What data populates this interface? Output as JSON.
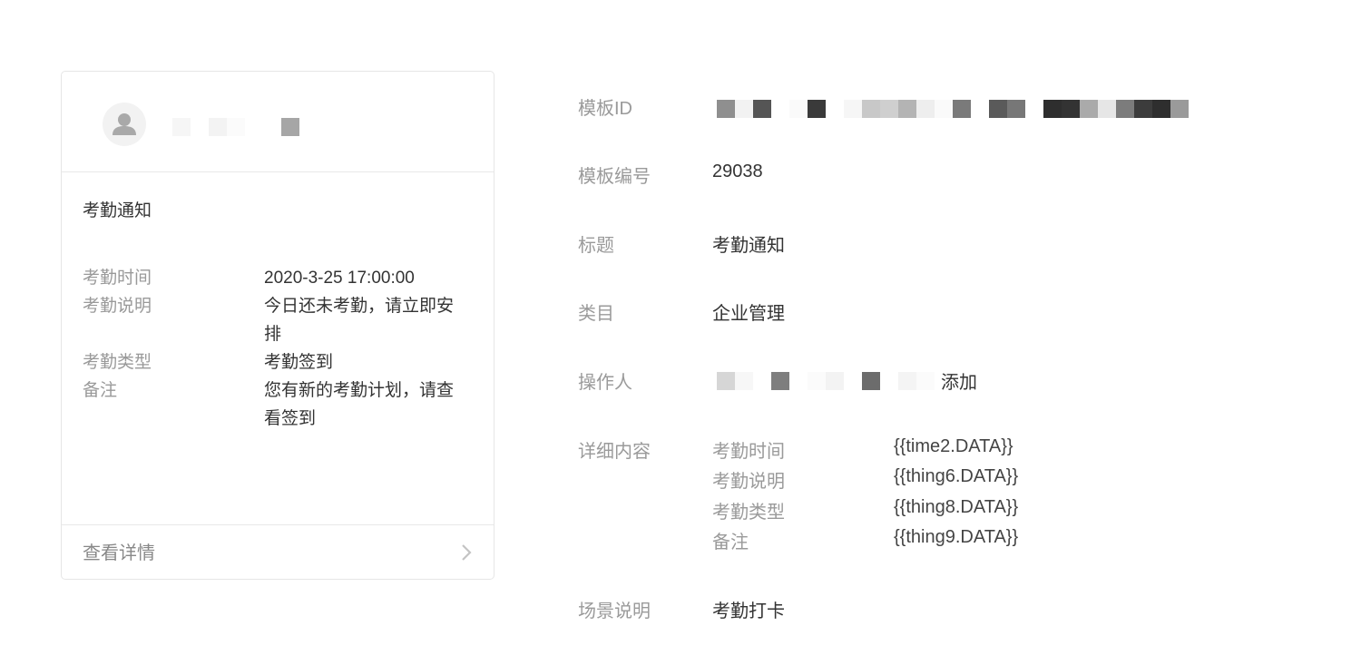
{
  "card": {
    "title": "考勤通知",
    "fields": [
      {
        "label": "考勤时间",
        "value": "2020-3-25 17:00:00"
      },
      {
        "label": "考勤说明",
        "value": "今日还未考勤，请立即安排"
      },
      {
        "label": "考勤类型",
        "value": "考勤签到"
      },
      {
        "label": "备注",
        "value": "您有新的考勤计划，请查看签到"
      }
    ],
    "footer_link": "查看详情",
    "avatar_icon": "user-avatar-icon",
    "chevron_icon": "chevron-right-icon"
  },
  "info": {
    "template_id_label": "模板ID",
    "template_number_label": "模板编号",
    "template_number": "29038",
    "title_label": "标题",
    "title": "考勤通知",
    "category_label": "类目",
    "category": "企业管理",
    "operator_label": "操作人",
    "operator_suffix": "添加",
    "detail_label": "详细内容",
    "details": [
      {
        "key": "考勤时间",
        "value": "{{time2.DATA}}"
      },
      {
        "key": "考勤说明",
        "value": "{{thing6.DATA}}"
      },
      {
        "key": "考勤类型",
        "value": "{{thing8.DATA}}"
      },
      {
        "key": "备注",
        "value": "{{thing9.DATA}}"
      }
    ],
    "scene_label": "场景说明",
    "scene": "考勤打卡"
  }
}
